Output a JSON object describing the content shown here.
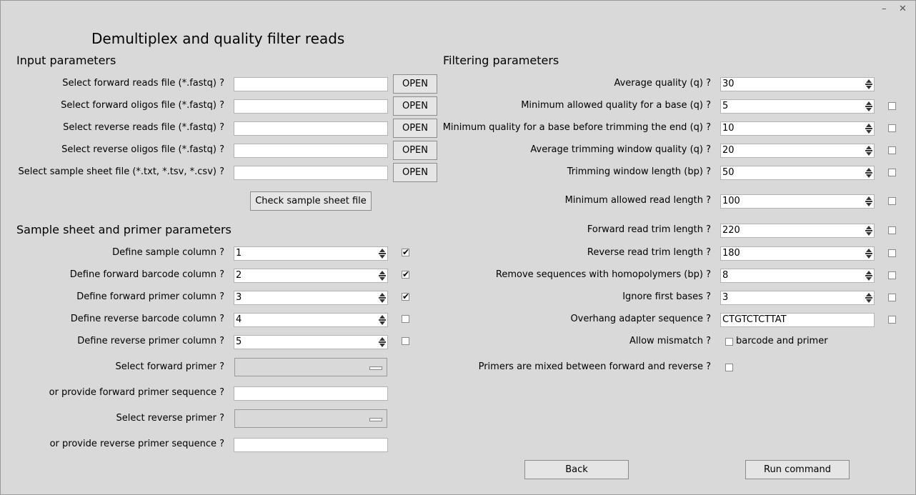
{
  "window": {
    "title": "Demultiplex and quality filter reads",
    "minimize_glyph": "–",
    "close_glyph": "✕"
  },
  "input": {
    "heading": "Input parameters",
    "open_label": "OPEN",
    "rows": [
      {
        "label": "Select forward reads file (*.fastq) ?",
        "value": ""
      },
      {
        "label": "Select forward oligos file (*.fastq) ?",
        "value": ""
      },
      {
        "label": "Select reverse reads file (*.fastq) ?",
        "value": ""
      },
      {
        "label": "Select reverse oligos file (*.fastq) ?",
        "value": ""
      },
      {
        "label": "Select sample sheet file (*.txt, *.tsv, *.csv) ?",
        "value": ""
      }
    ],
    "check_button": "Check sample sheet file"
  },
  "sheet": {
    "heading": "Sample sheet and primer parameters",
    "rows": [
      {
        "label": "Define sample column ?",
        "value": "1",
        "checked": true
      },
      {
        "label": "Define forward barcode column ?",
        "value": "2",
        "checked": true
      },
      {
        "label": "Define forward primer column ?",
        "value": "3",
        "checked": true
      },
      {
        "label": "Define reverse barcode column ?",
        "value": "4",
        "checked": false
      },
      {
        "label": "Define reverse primer column ?",
        "value": "5",
        "checked": false
      }
    ],
    "fwd_primer_label": "Select forward primer ?",
    "fwd_seq_label": "or provide forward primer sequence ?",
    "rev_primer_label": "Select reverse primer ?",
    "rev_seq_label": "or provide reverse primer sequence ?",
    "fwd_primer_value": "",
    "fwd_seq_value": "",
    "rev_primer_value": "",
    "rev_seq_value": ""
  },
  "filter": {
    "heading": "Filtering parameters",
    "rows": [
      {
        "label": "Average quality (q) ?",
        "value": "30",
        "checked": null
      },
      {
        "label": "Minimum allowed quality for a base (q) ?",
        "value": "5",
        "checked": false
      },
      {
        "label": "Minimum quality for a base before trimming the end (q) ?",
        "value": "10",
        "checked": false
      },
      {
        "label": "Average trimming window quality (q) ?",
        "value": "20",
        "checked": false
      },
      {
        "label": "Trimming window length (bp) ?",
        "value": "50",
        "checked": false
      },
      {
        "label": "Minimum allowed read length ?",
        "value": "100",
        "checked": false
      },
      {
        "label": "Forward read trim length ?",
        "value": "220",
        "checked": false
      },
      {
        "label": "Reverse read trim length ?",
        "value": "180",
        "checked": false
      },
      {
        "label": "Remove sequences with homopolymers (bp) ?",
        "value": "8",
        "checked": false
      },
      {
        "label": "Ignore first bases ?",
        "value": "3",
        "checked": false
      }
    ],
    "adapter_label": "Overhang adapter sequence ?",
    "adapter_value": "CTGTCTCTTAT",
    "adapter_checked": false,
    "mismatch_label": "Allow mismatch ?",
    "mismatch_option": "barcode and primer",
    "mismatch_checked": false,
    "mixed_label": "Primers are mixed between forward and reverse ?",
    "mixed_checked": false
  },
  "actions": {
    "back": "Back",
    "run": "Run command"
  },
  "check_glyph": "✔"
}
